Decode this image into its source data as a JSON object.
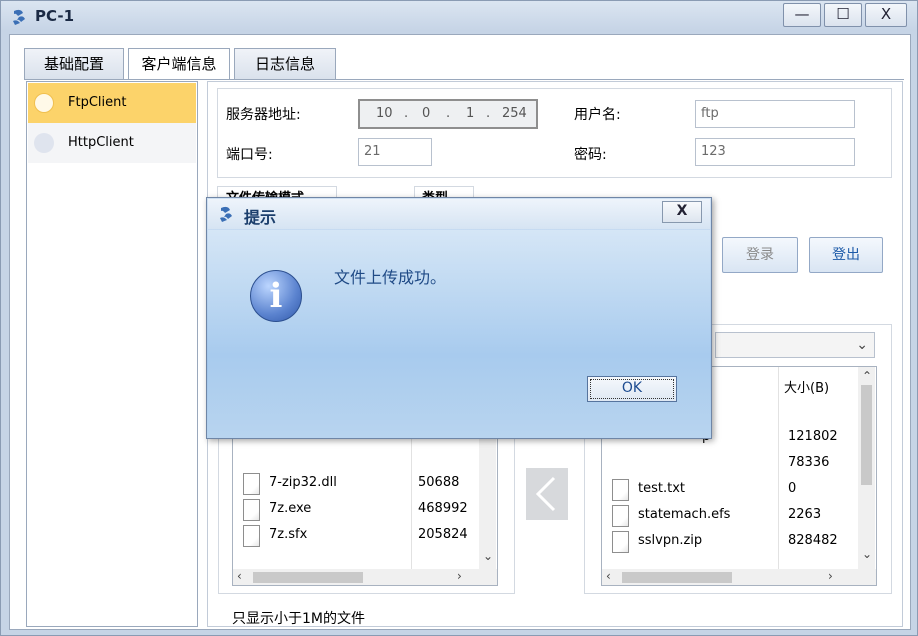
{
  "window": {
    "title": "PC-1",
    "minimize_label": "—",
    "maximize_label": "☐",
    "close_label": "X"
  },
  "tabs": [
    {
      "label": "基础配置"
    },
    {
      "label": "客户端信息"
    },
    {
      "label": "日志信息"
    }
  ],
  "clients": [
    {
      "label": "FtpClient",
      "selected": true
    },
    {
      "label": "HttpClient",
      "selected": false
    }
  ],
  "form": {
    "server_address_label": "服务器地址:",
    "ip_octets": [
      "10",
      "0",
      "1",
      "254"
    ],
    "port_label": "端口号:",
    "port_value": "21",
    "username_label": "用户名:",
    "username_value": "ftp",
    "password_label": "密码:",
    "password_value": "123",
    "transfer_mode_label": "文件传输模式",
    "type_label": "类型",
    "login_label": "登录",
    "logout_label": "登出"
  },
  "local_files": [
    {
      "name": "7-zip32.dll",
      "size": "50688"
    },
    {
      "name": "7z.exe",
      "size": "468992"
    },
    {
      "name": "7z.sfx",
      "size": "205824"
    }
  ],
  "server_files": {
    "size_header": "大小(B)",
    "partial_rows": [
      {
        "name": "p",
        "size": "121802"
      },
      {
        "name": "",
        "size": "78336"
      }
    ],
    "rows": [
      {
        "name": "test.txt",
        "size": "0"
      },
      {
        "name": "statemach.efs",
        "size": "2263"
      },
      {
        "name": "sslvpn.zip",
        "size": "828482"
      }
    ]
  },
  "footer_note": "只显示小于1M的文件",
  "dialog": {
    "title": "提示",
    "close_label": "X",
    "message": "文件上传成功。",
    "ok_label": "OK"
  },
  "colors": {
    "selected_item": "#fcd36a",
    "dialog_blue": "#a8cbee",
    "accent_text": "#1c5aa8"
  }
}
